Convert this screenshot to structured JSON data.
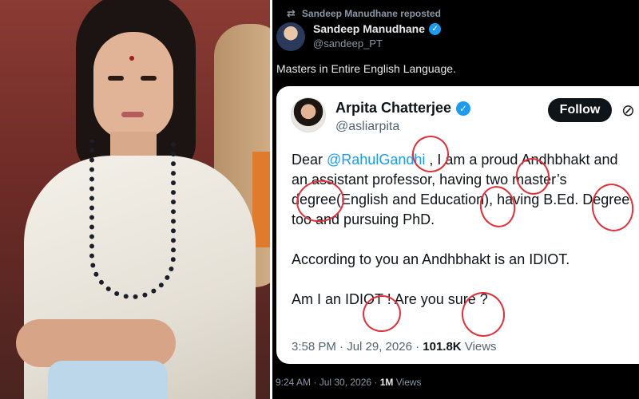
{
  "retweet": {
    "icon": "repost-icon",
    "text": "Sandeep Manudhane reposted"
  },
  "author": {
    "name": "Sandeep Manudhane",
    "handle": "@sandeep_PT",
    "verified_icon": "verified-badge-icon"
  },
  "tweet": {
    "text": "Masters in Entire English Language.",
    "time": "9:24 AM · Jul 30, 2026 ·",
    "views_count": "1M",
    "views_label": "Views"
  },
  "quoted": {
    "name": "Arpita Chatterjee",
    "handle": "@asliarpita",
    "follow_label": "Follow",
    "grok_icon": "grok-icon",
    "body": {
      "line1_pre": "Dear ",
      "mention": "@RahulGandhi",
      "line1_post": " , I am a proud Andhbhakt and",
      "line2": "an assistant professor, having two master’s",
      "line3": "degree(English and Education), having B.Ed. Degree",
      "line4": "too and pursuing PhD.",
      "line5": "According to you an Andhbhakt is an IDIOT.",
      "line6": "Am I an IDIOT ! Are you sure ?"
    },
    "footer": {
      "time": "3:58 PM · Jul 29, 2026 ·",
      "views_count": "101.8K",
      "views_label": "Views"
    }
  },
  "colors": {
    "dark_bg": "#000000",
    "link_blue": "#1d9bf0",
    "annotation_red": "#e0303a"
  }
}
